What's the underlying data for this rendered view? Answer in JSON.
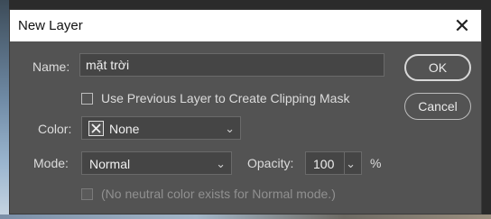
{
  "dialog": {
    "title": "New Layer",
    "close_label": "✕"
  },
  "name_field": {
    "label": "Name:",
    "value": "mặt trời"
  },
  "clipping_mask": {
    "label": "Use Previous Layer to Create Clipping Mask",
    "checked": false
  },
  "color_field": {
    "label": "Color:",
    "value": "None",
    "swatch_icon": "x-icon"
  },
  "mode_field": {
    "label": "Mode:",
    "value": "Normal"
  },
  "opacity_field": {
    "label": "Opacity:",
    "value": "100",
    "unit": "%"
  },
  "neutral_fill": {
    "label": "(No neutral color exists for Normal mode.)",
    "enabled": false
  },
  "buttons": {
    "ok": "OK",
    "cancel": "Cancel"
  }
}
